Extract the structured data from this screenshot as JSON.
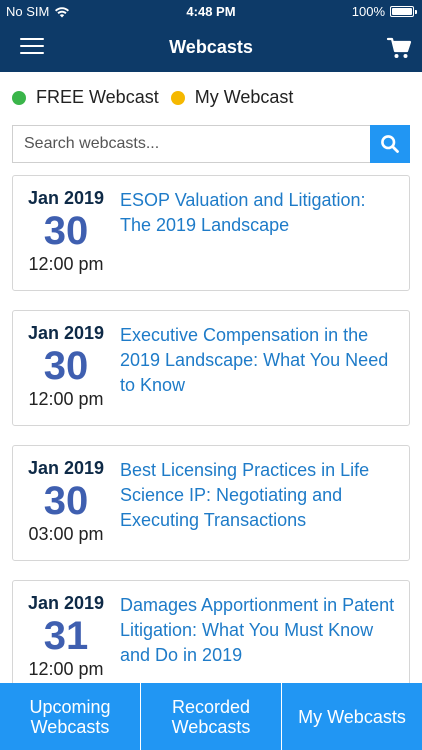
{
  "status_bar": {
    "carrier": "No SIM",
    "time": "4:48 PM",
    "battery": "100%",
    "battery_level": 1.0
  },
  "nav": {
    "title": "Webcasts",
    "menu_icon": "hamburger-menu-icon",
    "cart_icon": "shopping-cart-icon"
  },
  "legend": {
    "free_label": "FREE Webcast",
    "free_color": "#3ab54a",
    "my_label": "My Webcast",
    "my_color": "#f5b800"
  },
  "search": {
    "placeholder": "Search webcasts...",
    "value": "",
    "icon": "search-icon"
  },
  "webcasts": [
    {
      "month_year": "Jan 2019",
      "day": "30",
      "time": "12:00 pm",
      "title": "ESOP Valuation and Litigation: The 2019 Landscape"
    },
    {
      "month_year": "Jan 2019",
      "day": "30",
      "time": "12:00 pm",
      "title": "Executive Compensation in the 2019 Landscape: What You Need to Know"
    },
    {
      "month_year": "Jan 2019",
      "day": "30",
      "time": "03:00 pm",
      "title": "Best Licensing Practices in Life Science IP: Negotiating and Executing Transactions"
    },
    {
      "month_year": "Jan 2019",
      "day": "31",
      "time": "12:00 pm",
      "title": "Damages Apportionment in Patent Litigation: What You Must Know and Do in 2019"
    }
  ],
  "tabs": [
    {
      "label": "Upcoming\nWebcasts"
    },
    {
      "label": "Recorded\nWebcasts"
    },
    {
      "label": "My Webcasts"
    }
  ],
  "colors": {
    "nav_background": "#0d3a68",
    "accent": "#2196f3",
    "title_link": "#1e7bc8",
    "day_number": "#3f5fb0"
  }
}
